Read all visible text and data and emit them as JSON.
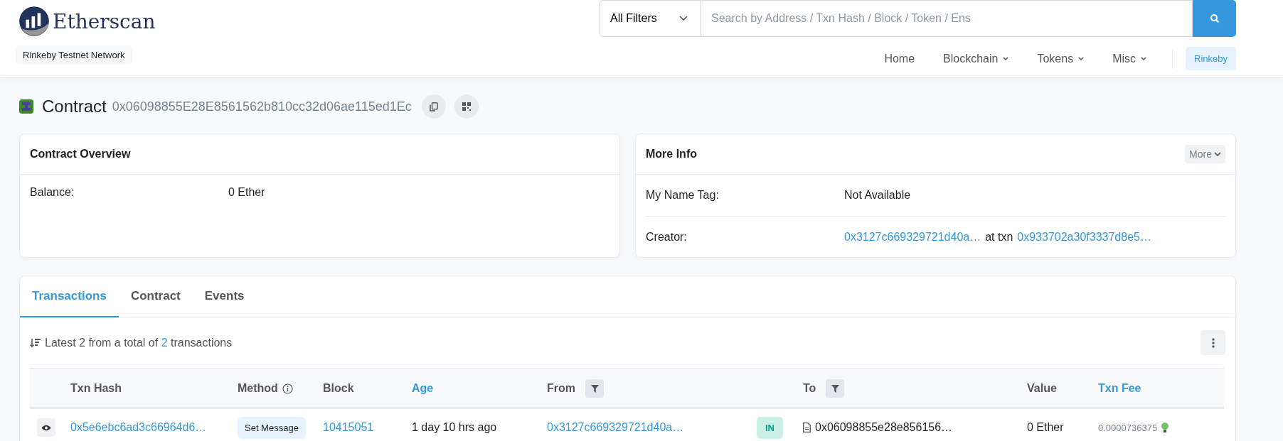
{
  "header": {
    "logo_text": "Etherscan",
    "network_badge": "Rinkeby Testnet Network",
    "search": {
      "filter": "All Filters",
      "placeholder": "Search by Address / Txn Hash / Block / Token / Ens"
    },
    "nav": [
      {
        "label": "Home",
        "dropdown": false
      },
      {
        "label": "Blockchain",
        "dropdown": true
      },
      {
        "label": "Tokens",
        "dropdown": true
      },
      {
        "label": "Misc",
        "dropdown": true
      }
    ],
    "network_button": "Rinkeby"
  },
  "contract": {
    "title": "Contract",
    "address": "0x06098855E28E8561562b810cc32d06ae115ed1Ec"
  },
  "overview": {
    "title": "Contract Overview",
    "rows": [
      {
        "label": "Balance:",
        "value": "0 Ether"
      }
    ]
  },
  "more_info": {
    "title": "More Info",
    "more_button": "More",
    "name_tag": {
      "label": "My Name Tag:",
      "value": "Not Available"
    },
    "creator": {
      "label": "Creator:",
      "address": "0x3127c669329721d40a…",
      "at_text": "at txn",
      "txn": "0x933702a30f3337d8e5…"
    }
  },
  "tabs": [
    {
      "label": "Transactions",
      "selected": true
    },
    {
      "label": "Contract",
      "selected": false
    },
    {
      "label": "Events",
      "selected": false
    }
  ],
  "summary": {
    "prefix": "Latest 2 from a total of",
    "count": "2",
    "suffix": "transactions"
  },
  "table": {
    "columns": [
      {
        "label": "Txn Hash",
        "kind": "plain"
      },
      {
        "label": "Method",
        "kind": "info"
      },
      {
        "label": "Block",
        "kind": "plain"
      },
      {
        "label": "Age",
        "kind": "toggle"
      },
      {
        "label": "From",
        "kind": "filter"
      },
      {
        "label": "To",
        "kind": "filter"
      },
      {
        "label": "Value",
        "kind": "plain"
      },
      {
        "label": "Txn Fee",
        "kind": "toggle"
      }
    ],
    "rows": [
      {
        "txn_hash": "0x5e6ebc6ad3c66964d6…",
        "method": "Set Message",
        "block": "10415051",
        "age": "1 day 10 hrs ago",
        "from": "0x3127c669329721d40a…",
        "direction": "IN",
        "to": "0x06098855e28e856156…",
        "value": "0 Ether",
        "fee": "0.0000736375"
      }
    ]
  }
}
